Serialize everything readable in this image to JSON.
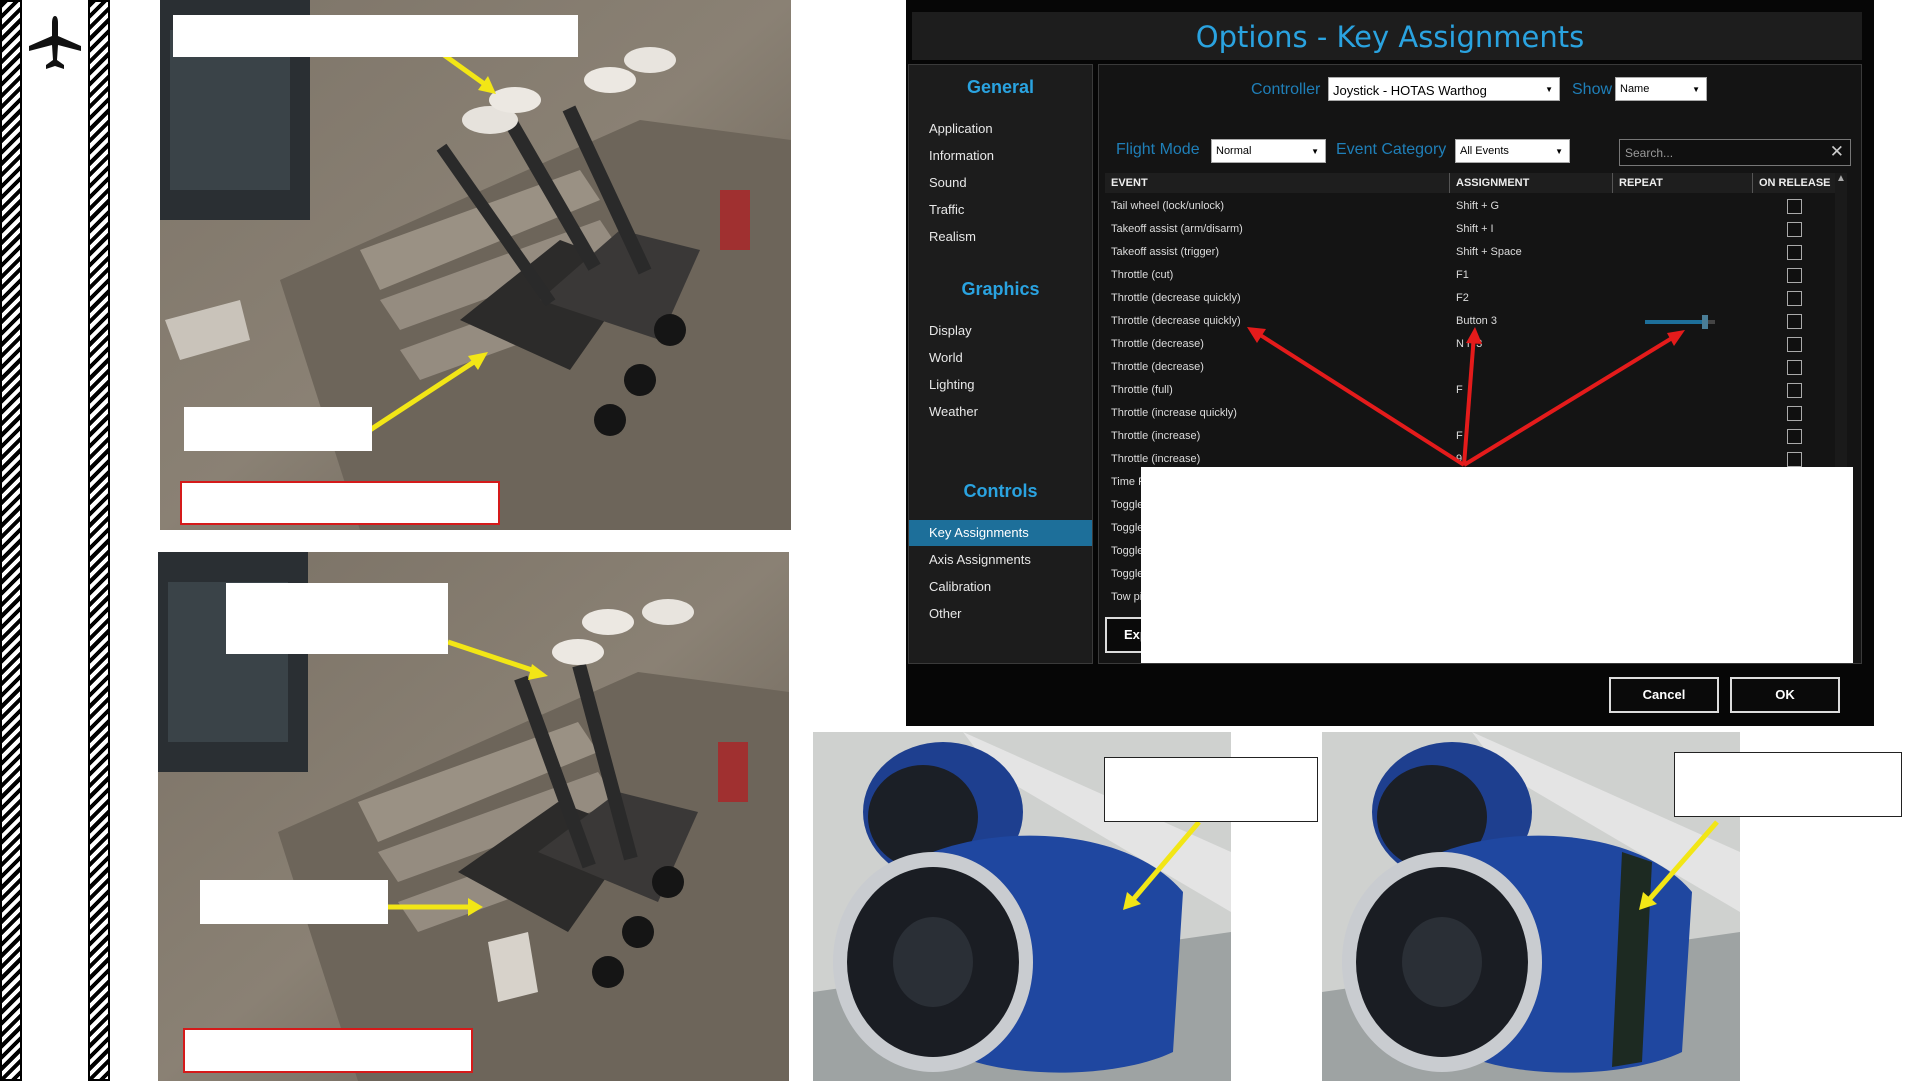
{
  "dialog": {
    "title": "Options - Key Assignments",
    "sidebar": {
      "sections": [
        {
          "heading": "General",
          "items": [
            "Application",
            "Information",
            "Sound",
            "Traffic",
            "Realism"
          ]
        },
        {
          "heading": "Graphics",
          "items": [
            "Display",
            "World",
            "Lighting",
            "Weather"
          ]
        },
        {
          "heading": "Controls",
          "items": [
            "Key Assignments",
            "Axis Assignments",
            "Calibration",
            "Other"
          ]
        }
      ],
      "active_item": "Key Assignments"
    },
    "controller_label": "Controller",
    "controller_value": "Joystick - HOTAS Warthog",
    "show_label": "Show",
    "show_value": "Name",
    "flight_mode_label": "Flight Mode",
    "flight_mode_value": "Normal",
    "event_category_label": "Event Category",
    "event_category_value": "All Events",
    "search_placeholder": "Search...",
    "columns": [
      "EVENT",
      "ASSIGNMENT",
      "REPEAT",
      "ON RELEASE"
    ],
    "rows": [
      {
        "event": "Tail wheel (lock/unlock)",
        "assignment": "Shift + G"
      },
      {
        "event": "Takeoff assist (arm/disarm)",
        "assignment": "Shift + I"
      },
      {
        "event": "Takeoff assist (trigger)",
        "assignment": "Shift + Space"
      },
      {
        "event": "Throttle (cut)",
        "assignment": "F1"
      },
      {
        "event": "Throttle (decrease quickly)",
        "assignment": "F2"
      },
      {
        "event": "Throttle (decrease quickly)",
        "assignment": "Button 3"
      },
      {
        "event": "Throttle (decrease)",
        "assignment": "N  n 3"
      },
      {
        "event": "Throttle (decrease)",
        "assignment": ""
      },
      {
        "event": "Throttle (full)",
        "assignment": "F"
      },
      {
        "event": "Throttle (increase quickly)",
        "assignment": ""
      },
      {
        "event": "Throttle (increase)",
        "assignment": "F"
      },
      {
        "event": "Throttle (increase)",
        "assignment": "   9"
      },
      {
        "event": "Time P",
        "assignment": ""
      },
      {
        "event": "Toggle",
        "assignment": ""
      },
      {
        "event": "Toggle",
        "assignment": ""
      },
      {
        "event": "Toggle",
        "assignment": ""
      },
      {
        "event": "Toggle",
        "assignment": ""
      },
      {
        "event": "Tow pi",
        "assignment": ""
      }
    ],
    "repeat_slider_value": 0.85,
    "export_label": "Exp",
    "cancel_label": "Cancel",
    "ok_label": "OK"
  },
  "colors": {
    "accent": "#2aa3e0",
    "active": "#1d6f9a",
    "arrow_red": "#e41b1b",
    "arrow_yellow": "#f2e616",
    "callout_border": "#d51a1a"
  },
  "icons": [
    "airplane-icon",
    "chevron-down-icon",
    "close-icon"
  ]
}
